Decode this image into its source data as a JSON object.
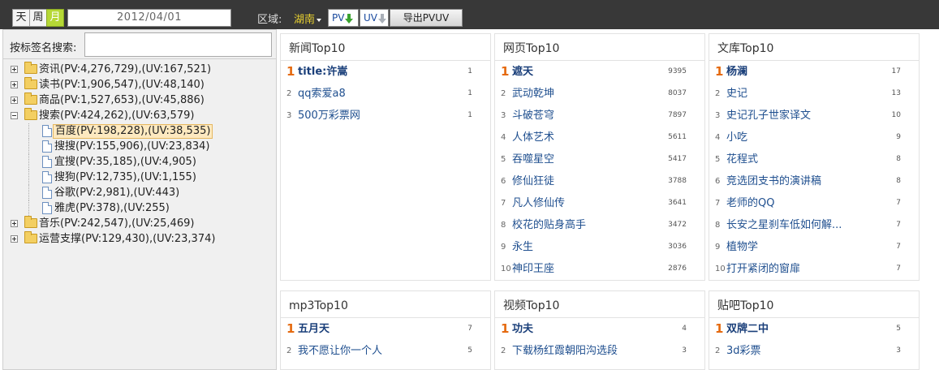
{
  "toolbar": {
    "periods": [
      {
        "label": "天",
        "active": false
      },
      {
        "label": "周",
        "active": false
      },
      {
        "label": "月",
        "active": true
      }
    ],
    "date": "2012/04/01",
    "region_label": "区域:",
    "region_value": "湖南",
    "pv_label": "PV",
    "uv_label": "UV",
    "export_label": "导出PVUV",
    "colors": {
      "active_period": "#b6d836",
      "region_text": "#e8d030",
      "arrow_green": "#3ba32f"
    }
  },
  "sidebar": {
    "search_label": "按标签名搜索:",
    "search_value": "",
    "tree": [
      {
        "label": "资讯(PV:4,276,729),(UV:167,521)",
        "expanded": false
      },
      {
        "label": "读书(PV:1,906,547),(UV:48,140)",
        "expanded": false
      },
      {
        "label": "商品(PV:1,527,653),(UV:45,886)",
        "expanded": false
      },
      {
        "label": "搜索(PV:424,262),(UV:63,579)",
        "expanded": true,
        "children": [
          {
            "label": "百度(PV:198,228),(UV:38,535)",
            "selected": true
          },
          {
            "label": "搜搜(PV:155,906),(UV:23,834)"
          },
          {
            "label": "宜搜(PV:35,185),(UV:4,905)"
          },
          {
            "label": "搜狗(PV:12,735),(UV:1,155)"
          },
          {
            "label": "谷歌(PV:2,981),(UV:443)"
          },
          {
            "label": "雅虎(PV:378),(UV:255)"
          }
        ]
      },
      {
        "label": "音乐(PV:242,547),(UV:25,469)",
        "expanded": false
      },
      {
        "label": "运营支撑(PV:129,430),(UV:23,374)",
        "expanded": false
      }
    ]
  },
  "panels": [
    {
      "title": "新闻Top10",
      "items": [
        {
          "rank": "1",
          "term": "title:许嵩",
          "count": "1"
        },
        {
          "rank": "2",
          "term": "qq索爱a8",
          "count": "1"
        },
        {
          "rank": "3",
          "term": "500万彩票网",
          "count": "1"
        }
      ]
    },
    {
      "title": "网页Top10",
      "items": [
        {
          "rank": "1",
          "term": "遮天",
          "count": "9395"
        },
        {
          "rank": "2",
          "term": "武动乾坤",
          "count": "8037"
        },
        {
          "rank": "3",
          "term": "斗破苍穹",
          "count": "7897"
        },
        {
          "rank": "4",
          "term": "人体艺术",
          "count": "5611"
        },
        {
          "rank": "5",
          "term": "吞噬星空",
          "count": "5417"
        },
        {
          "rank": "6",
          "term": "修仙狂徒",
          "count": "3788"
        },
        {
          "rank": "7",
          "term": "凡人修仙传",
          "count": "3641"
        },
        {
          "rank": "8",
          "term": "校花的贴身高手",
          "count": "3472"
        },
        {
          "rank": "9",
          "term": "永生",
          "count": "3036"
        },
        {
          "rank": "10",
          "term": "神印王座",
          "count": "2876"
        }
      ]
    },
    {
      "title": "文库Top10",
      "items": [
        {
          "rank": "1",
          "term": "杨澜",
          "count": "17"
        },
        {
          "rank": "2",
          "term": "史记",
          "count": "13"
        },
        {
          "rank": "3",
          "term": "史记孔子世家译文",
          "count": "10"
        },
        {
          "rank": "4",
          "term": "小吃",
          "count": "9"
        },
        {
          "rank": "5",
          "term": "花程式",
          "count": "8"
        },
        {
          "rank": "6",
          "term": "竞选团支书的演讲稿",
          "count": "8"
        },
        {
          "rank": "7",
          "term": "老师的QQ",
          "count": "7"
        },
        {
          "rank": "8",
          "term": "长安之星刹车低如何解...",
          "count": "7"
        },
        {
          "rank": "9",
          "term": "植物学",
          "count": "7"
        },
        {
          "rank": "10",
          "term": "打开紧闭的窗扉",
          "count": "7"
        }
      ]
    },
    {
      "title": "mp3Top10",
      "items": [
        {
          "rank": "1",
          "term": "五月天",
          "count": "7"
        },
        {
          "rank": "2",
          "term": "我不愿让你一个人",
          "count": "5"
        }
      ]
    },
    {
      "title": "视频Top10",
      "items": [
        {
          "rank": "1",
          "term": "功夫",
          "count": "4"
        },
        {
          "rank": "2",
          "term": "下载杨红霞朝阳沟选段",
          "count": "3"
        }
      ]
    },
    {
      "title": "贴吧Top10",
      "items": [
        {
          "rank": "1",
          "term": "双牌二中",
          "count": "5"
        },
        {
          "rank": "2",
          "term": "3d彩票",
          "count": "3"
        }
      ]
    }
  ]
}
